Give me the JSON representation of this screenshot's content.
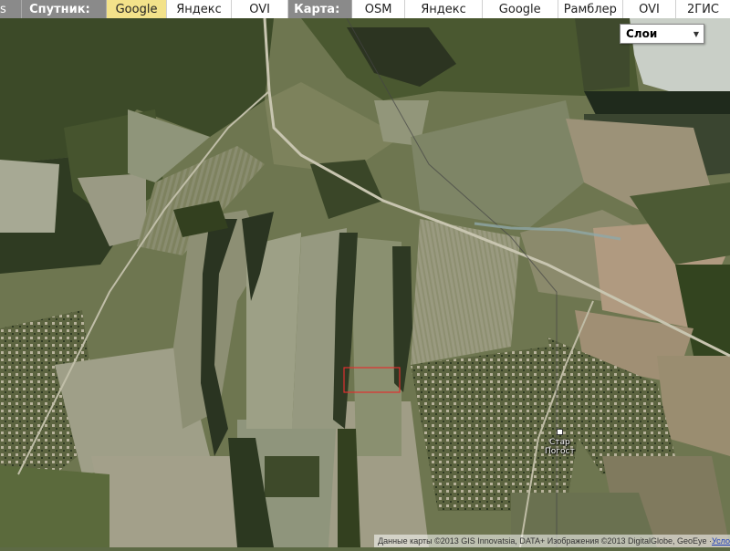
{
  "topbar": {
    "edge_label": "s",
    "satellite_label": "Спутник:",
    "satellite_options": [
      "Google",
      "Яндекс",
      "OVI"
    ],
    "satellite_active": "Google",
    "map_label": "Карта:",
    "map_options": [
      "OSM",
      "Яндекс",
      "Google",
      "Рамблер",
      "OVI",
      "2ГИС"
    ]
  },
  "layers": {
    "label": "Слои",
    "icon": "triangle-down"
  },
  "place_label": {
    "line1": "Стар",
    "line2": "Погост"
  },
  "attribution": {
    "text": "Данные карты ©2013 GIS Innovatsia, DATA+ Изображения ©2013 DigitalGlobe, GeoEye · ",
    "link": "Усло"
  },
  "colors": {
    "active_tab": "#f3e28a",
    "label_bg": "#8a8a8a",
    "marker": "#e03030"
  }
}
